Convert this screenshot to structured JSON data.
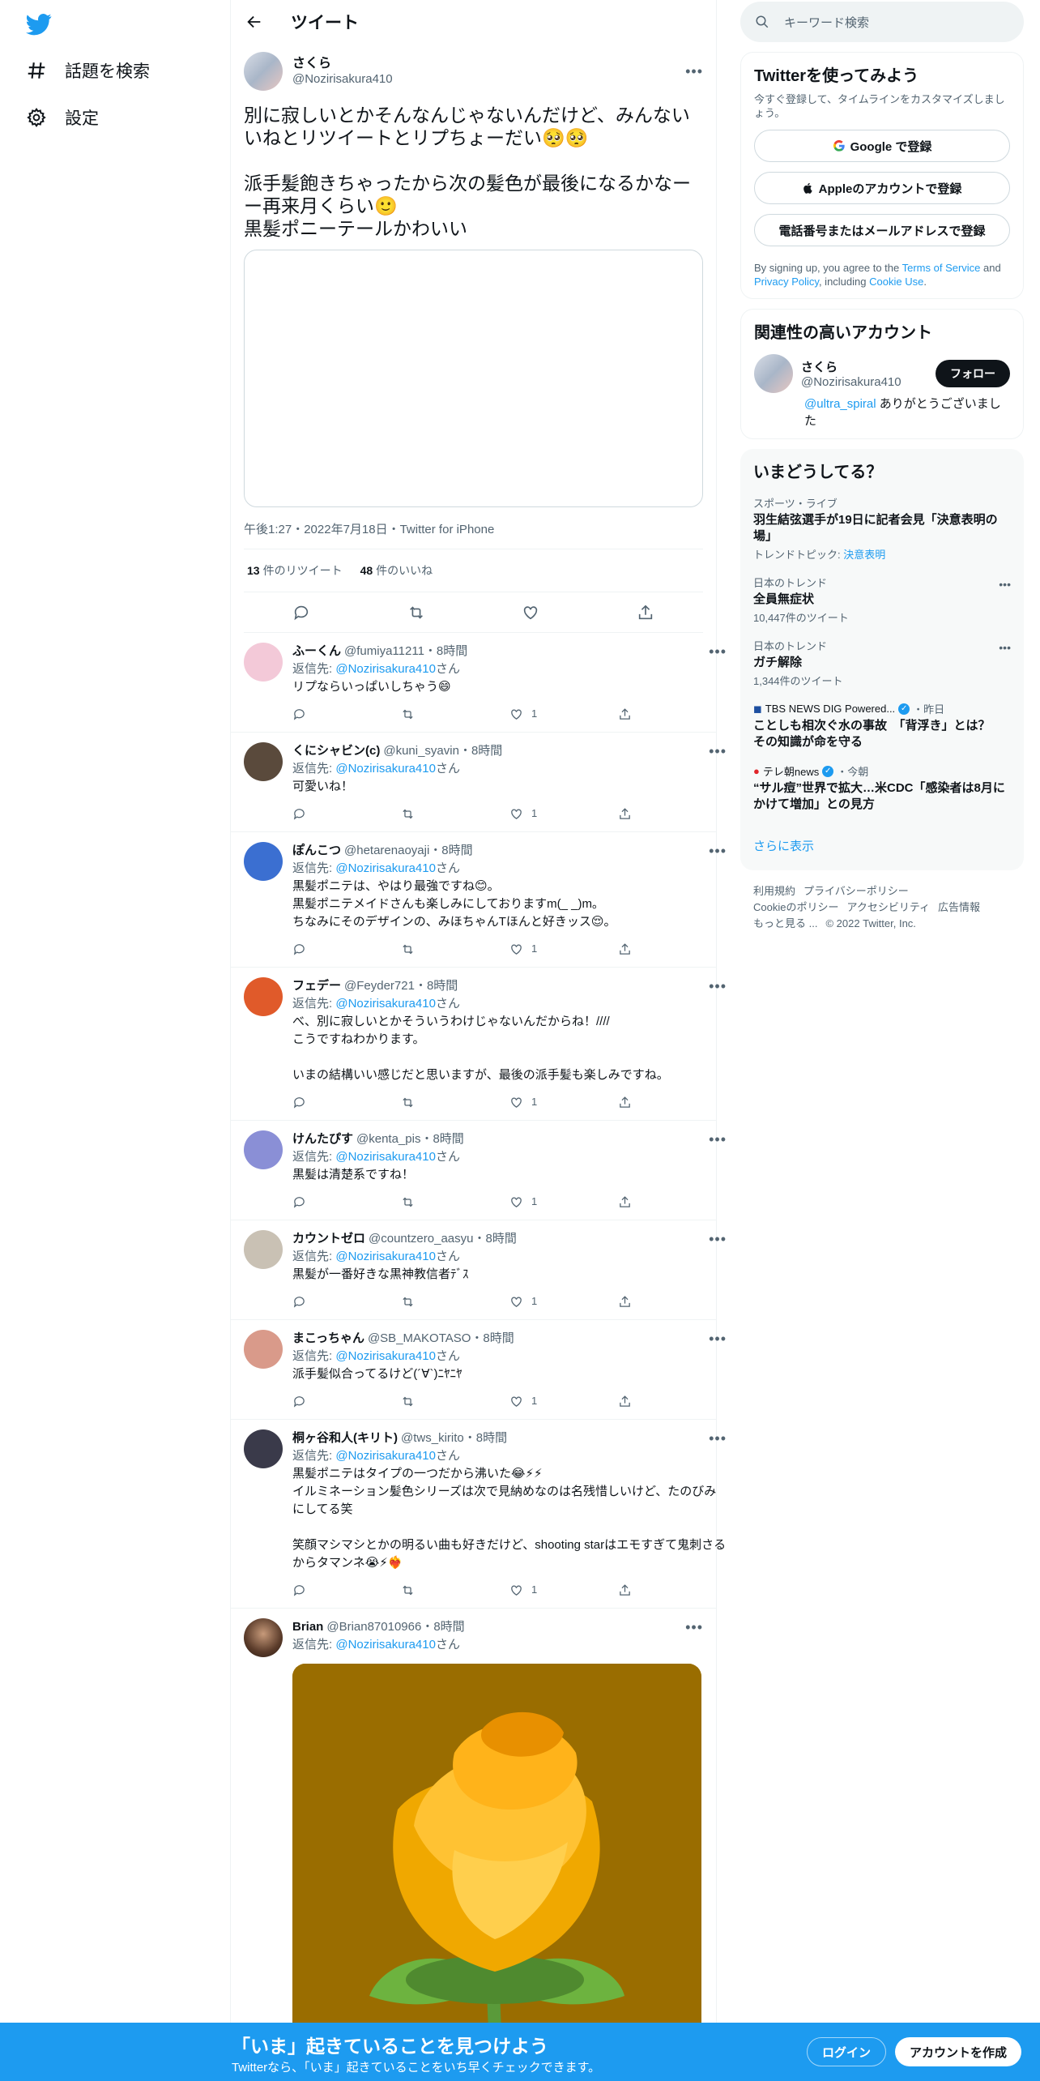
{
  "nav": {
    "explore_label": "話題を検索",
    "settings_label": "設定"
  },
  "header": {
    "title": "ツイート"
  },
  "tweet": {
    "name": "さくら",
    "handle": "@Nozirisakura410",
    "text": "別に寂しいとかそんなんじゃないんだけど、みんないいねとリツイートとリプちょーだい🥺🥺\n\n派手髪飽きちゃったから次の髪色が最後になるかなーー再来月くらい🙂\n黒髪ポニーテールかわいい",
    "meta": "午後1:27・2022年7月18日・Twitter for iPhone",
    "retweets": "13",
    "retweets_label": "件のリツイート",
    "likes": "48",
    "likes_label": "件のいいね"
  },
  "reply_to_label": "返信先: ",
  "reply_to_mention": "@Nozirisakura410",
  "reply_to_suffix": "さん",
  "replies": [
    {
      "name": "ふーくん",
      "meta": "@fumiya11211・8時間",
      "text": "リプならいっぱいしちゃう😄",
      "likes": "1",
      "avatar_color": "#f3c9d8"
    },
    {
      "name": "くにシャビン(c)",
      "meta": "@kuni_syavin・8時間",
      "text": "可愛いね！",
      "likes": "1",
      "avatar_color": "#5a4a3c"
    },
    {
      "name": "ぽんこつ",
      "meta": "@hetarenaoyaji・8時間",
      "text": "黒髪ポニテは、やはり最強ですね😊。\n黒髪ポニテメイドさんも楽しみにしておりますm(_ _)m。\nちなみにそのデザインの、みほちゃんTほんと好きッス😌。",
      "likes": "1",
      "avatar_color": "#3b6fd1"
    },
    {
      "name": "フェデー",
      "meta": "@Feyder721・8時間",
      "text": "べ、別に寂しいとかそういうわけじゃないんだからね！////\nこうですねわかります。\n\nいまの結構いい感じだと思いますが、最後の派手髪も楽しみですね。",
      "likes": "1",
      "avatar_color": "#e05a2a"
    },
    {
      "name": "けんたぴす",
      "meta": "@kenta_pis・8時間",
      "text": "黒髪は清楚系ですね！",
      "likes": "1",
      "avatar_color": "#8a8fd6"
    },
    {
      "name": "カウントゼロ",
      "meta": "@countzero_aasyu・8時間",
      "text": "黒髪が一番好きな黒神教信者ﾃﾞｽ",
      "likes": "1",
      "avatar_color": "#c9c1b4"
    },
    {
      "name": "まこっちゃん",
      "meta": "@SB_MAKOTASO・8時間",
      "text": "派手髪似合ってるけど(´∀`)ﾆﾔﾆﾔ",
      "likes": "1",
      "avatar_color": "#d99a8a"
    },
    {
      "name": "桐ヶ谷和人(キリト)",
      "meta": "@tws_kirito・8時間",
      "text": "黒髪ポニテはタイプの一つだから沸いた😂⚡⚡\nイルミネーション髪色シリーズは次で見納めなのは名残惜しいけど、たのびみにしてる笑\n\n笑顔マシマシとかの明るい曲も好きだけど、shooting starはエモすぎて鬼刺さるからタマンネ😭⚡❤️‍🔥",
      "likes": "1",
      "avatar_color": "#3a3a4a"
    }
  ],
  "last_reply": {
    "name": "Brian",
    "meta": "@Brian87010966・8時間"
  },
  "right": {
    "search_placeholder": "キーワード検索",
    "signup_card": {
      "title": "Twitterを使ってみよう",
      "sub": "今すぐ登録して、タイムラインをカスタマイズしましょう。",
      "google": "Google で登録",
      "apple": "Appleのアカウントで登録",
      "phone": "電話番号またはメールアドレスで登録",
      "terms_1": "By signing up, you agree to the ",
      "terms_tos": "Terms of Service",
      "terms_2": " and ",
      "terms_pp": "Privacy Policy",
      "terms_3": ", including ",
      "terms_cookie": "Cookie Use",
      "terms_4": "."
    },
    "related": {
      "title": "関連性の高いアカウント",
      "name": "さくら",
      "handle": "@Nozirisakura410",
      "follow": "フォロー",
      "bio_mention": "@ultra_spiral",
      "bio_text": " ありがとうございました"
    },
    "trends": {
      "title": "いまどうしてる？",
      "items": [
        {
          "cat": "スポーツ・ライブ",
          "title": "羽生結弦選手が19日に記者会見「決意表明の場」",
          "count_prefix": "トレンドトピック: ",
          "count_link": "決意表明"
        },
        {
          "cat": "日本のトレンド",
          "title": "全員無症状",
          "count": "10,447件のツイート"
        },
        {
          "cat": "日本のトレンド",
          "title": "ガチ解除",
          "count": "1,344件のツイート"
        }
      ],
      "news": [
        {
          "src": "TBS NEWS DIG Powered...",
          "time": "・昨日",
          "title": "ことしも相次ぐ水の事故　「背浮き」とは？　その知識が命を守る"
        },
        {
          "src": "テレ朝news",
          "time": "・今朝",
          "title": "“サル痘”世界で拡大…米CDC「感染者は8月にかけて増加」との見方"
        }
      ],
      "show_more": "さらに表示"
    },
    "footer": {
      "l1": "利用規約",
      "l2": "プライバシーポリシー",
      "l3": "Cookieのポリシー",
      "l4": "アクセシビリティ",
      "l5": "広告情報",
      "l6": "もっと見る ...",
      "l7": "© 2022 Twitter, Inc."
    }
  },
  "bottombar": {
    "title": "「いま」起きていることを見つけよう",
    "sub": "Twitterなら、「いま」起きていることをいち早くチェックできます。",
    "login": "ログイン",
    "signup": "アカウントを作成"
  },
  "colors": {
    "accent": "#1d9bf0",
    "text": "#0f1419",
    "muted": "#536471"
  }
}
